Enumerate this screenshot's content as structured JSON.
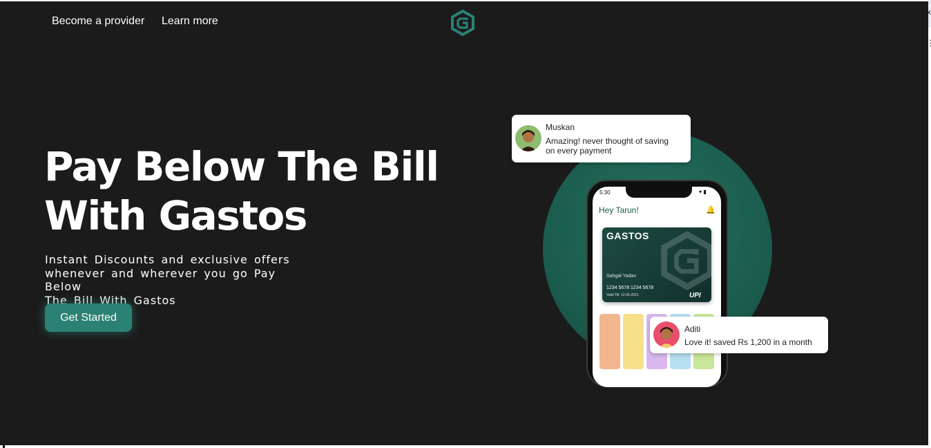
{
  "nav": {
    "become_provider": "Become a provider",
    "learn_more": "Learn more"
  },
  "hero": {
    "headline_line1": "Pay Below The Bill",
    "headline_line2": "With Gastos",
    "subtext_line1": "Instant Discounts and exclusive offers",
    "subtext_line2": "whenever and wherever you go Pay Below",
    "subtext_line3": "The Bill With Gastos",
    "cta_label": "Get Started"
  },
  "phone": {
    "status_time": "5:30",
    "greeting": "Hey Tarun!",
    "card_brand": "GASTOS",
    "card_holder": "Sahgal Yadav",
    "card_number": "1234 5678 1234 5678",
    "card_valid": "Valid Till: 12-06-2021",
    "card_network": "UPI"
  },
  "testimonials": [
    {
      "name": "Muskan",
      "message_line1": "Amazing! never thought of saving",
      "message_line2": "on every payment"
    },
    {
      "name": "Aditi",
      "message_line1": "Love it! saved Rs 1,200 in a month"
    }
  ],
  "colors": {
    "background": "#1b1b1b",
    "accent": "#2b8173",
    "circle": "#1a5b4c",
    "text": "#ffffff"
  },
  "icons": [
    "gastos-logo-icon",
    "bell-icon",
    "close-icon",
    "more-vertical-icon"
  ]
}
